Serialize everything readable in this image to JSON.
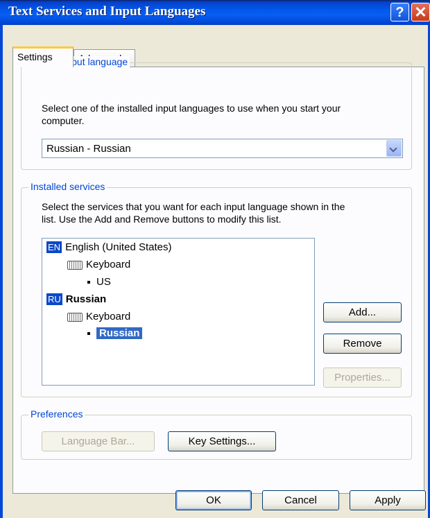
{
  "window": {
    "title": "Text Services and Input Languages",
    "help_glyph": "?",
    "close_glyph": "✕"
  },
  "tabs": [
    {
      "label": "Settings",
      "active": true
    },
    {
      "label": "Advanced",
      "active": false
    }
  ],
  "default_input": {
    "legend": "Default input language",
    "description_line1": "Select one of the installed input languages to use when you start your",
    "description_line2": "computer.",
    "selected": "Russian - Russian"
  },
  "installed_services": {
    "legend": "Installed services",
    "description_line1": "Select the services that you want for each input language shown in the",
    "description_line2": "list. Use the Add and Remove buttons to modify this list.",
    "tree": [
      {
        "icon": "EN",
        "label": "English (United States)"
      },
      {
        "label": "Keyboard"
      },
      {
        "label": "US"
      },
      {
        "icon": "RU",
        "label": "Russian"
      },
      {
        "label": "Keyboard"
      },
      {
        "label": "Russian",
        "selected": true
      }
    ],
    "add_label": "Add...",
    "remove_label": "Remove",
    "properties_label": "Properties..."
  },
  "preferences": {
    "legend": "Preferences",
    "language_bar_label": "Language Bar...",
    "key_settings_label": "Key Settings..."
  },
  "footer": {
    "ok_label": "OK",
    "cancel_label": "Cancel",
    "apply_label": "Apply"
  },
  "colors": {
    "titlebar": "#0058ee",
    "legend_text": "#0046d5",
    "selection": "#316ac5",
    "dialog_bg": "#ece9d8"
  }
}
